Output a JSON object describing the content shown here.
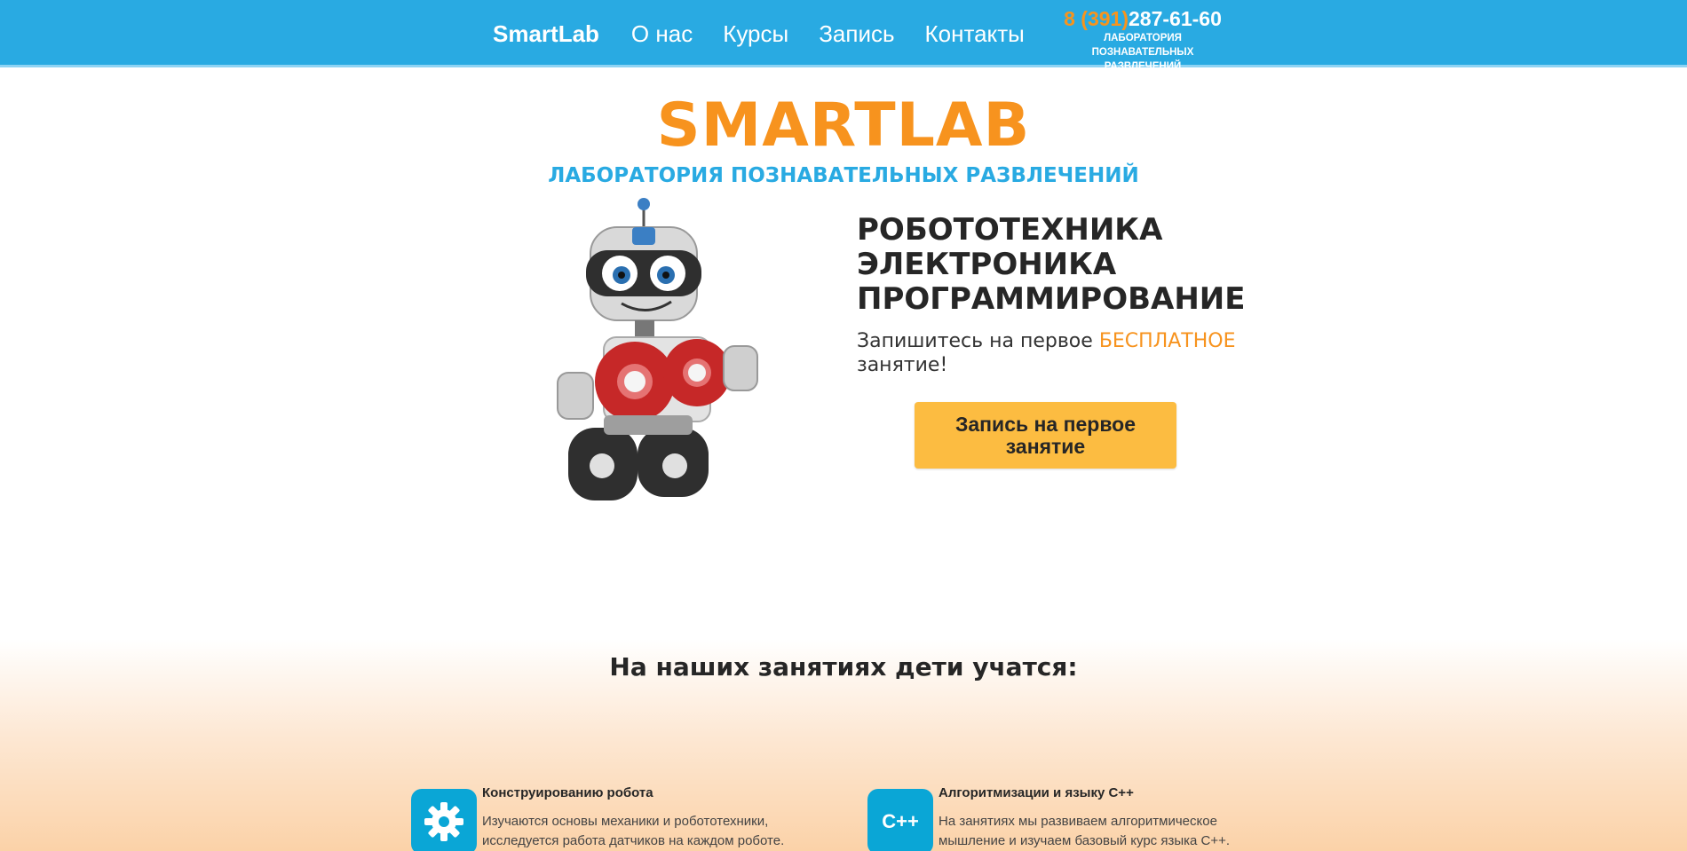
{
  "header": {
    "brand": "SmartLab",
    "nav": [
      "О нас",
      "Курсы",
      "Запись",
      "Контакты"
    ],
    "phone_code": "8 (391)",
    "phone_number": "287-61-60",
    "tagline": "ЛАБОРАТОРИЯ ПОЗНАВАТЕЛЬНЫХ РАЗВЛЕЧЕНИЙ"
  },
  "hero": {
    "title": "SMARTLAB",
    "subtitle": "ЛАБОРАТОРИЯ ПОЗНАВАТЕЛЬНЫХ РАЗВЛЕЧЕНИЙ",
    "lines": [
      "РОБОТОТЕХНИКА",
      "ЭЛЕКТРОНИКА",
      "ПРОГРАММИРОВАНИЕ"
    ],
    "invite_before": "Запишитесь на первое ",
    "invite_highlight": "БЕСПЛАТНОЕ",
    "invite_after": " занятие!",
    "cta": "Запись на первое занятие"
  },
  "learn": {
    "title": "На наших занятиях дети учатся:",
    "features": [
      {
        "icon": "gear-icon",
        "title": "Конструированию робота",
        "desc": "Изучаются основы механики и робототехники, исследуется работа датчиков на каждом роботе."
      },
      {
        "icon": "cpp-icon",
        "icon_text": "C++",
        "title": "Алгоритмизации и языку С++",
        "desc": "На занятиях мы развиваем алгоритмическое мышление и изучаем базовый курс языка С++."
      }
    ]
  },
  "colors": {
    "header_bg": "#29aae2",
    "accent_orange": "#f7931e",
    "cta_bg": "#fcbc41",
    "icon_bg": "#0aa6d6"
  }
}
